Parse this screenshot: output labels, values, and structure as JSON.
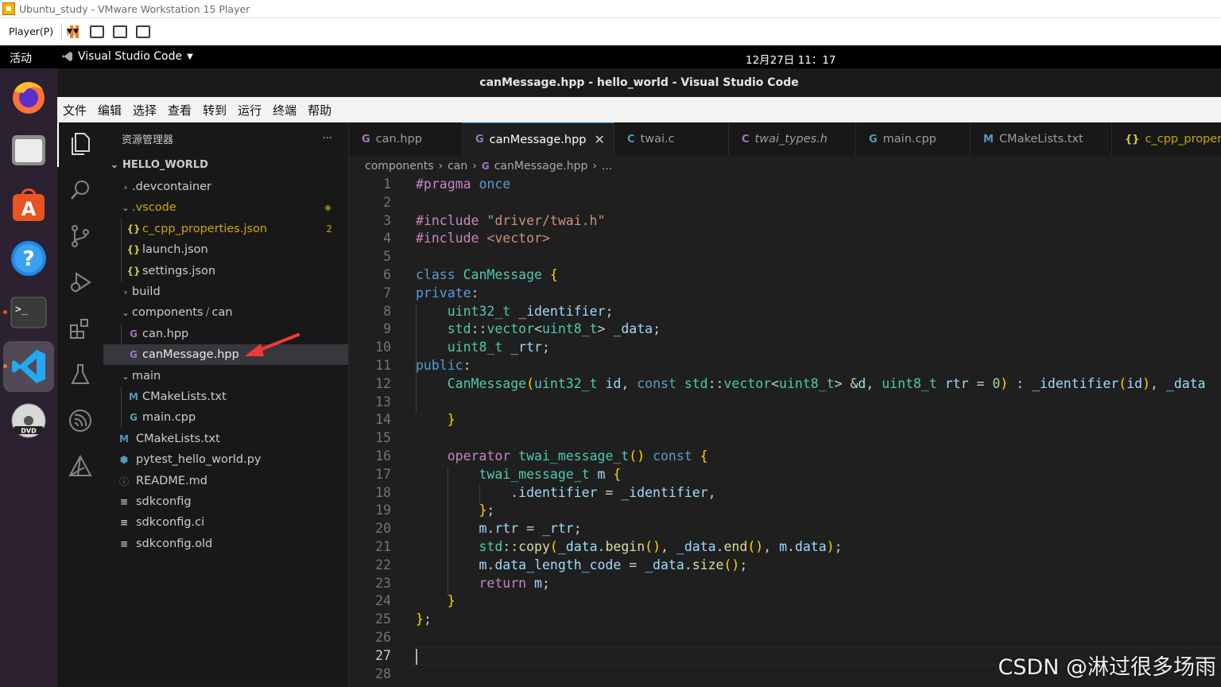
{
  "vm": {
    "title": "Ubuntu_study - VMware Workstation 15 Player",
    "player_label": "Player(P)"
  },
  "topbar": {
    "activities": "活动",
    "app_menu": "Visual Studio Code",
    "clock": "12月27日  11：17"
  },
  "dock": {
    "items": [
      "firefox-icon",
      "files-icon",
      "software-icon",
      "help-icon",
      "terminal-icon",
      "vscode-icon",
      "dvd-icon"
    ]
  },
  "window": {
    "title": "canMessage.hpp - hello_world - Visual Studio Code"
  },
  "menubar": {
    "items": [
      "文件",
      "编辑",
      "选择",
      "查看",
      "转到",
      "运行",
      "终端",
      "帮助"
    ]
  },
  "sidebar": {
    "header": "资源管理器",
    "more": "···",
    "root": "HELLO_WORLD",
    "items": [
      {
        "label": ".devcontainer",
        "icon": "chevron-right"
      },
      {
        "label": ".vscode",
        "icon": "chevron-down"
      },
      {
        "label": "c_cpp_properties.json",
        "icon": "{}",
        "badge": "2"
      },
      {
        "label": "launch.json",
        "icon": "{}"
      },
      {
        "label": "settings.json",
        "icon": "{}"
      },
      {
        "label": "build",
        "icon": "chevron-right"
      },
      {
        "label": "components",
        "label2": "can",
        "icon": "chevron-down"
      },
      {
        "label": "can.hpp",
        "icon": "C++"
      },
      {
        "label": "canMessage.hpp",
        "icon": "C++"
      },
      {
        "label": "main",
        "icon": "chevron-down"
      },
      {
        "label": "CMakeLists.txt",
        "icon": "M"
      },
      {
        "label": "main.cpp",
        "icon": "C++"
      },
      {
        "label": "CMakeLists.txt",
        "icon": "M"
      },
      {
        "label": "pytest_hello_world.py",
        "icon": "python"
      },
      {
        "label": "README.md",
        "icon": "info"
      },
      {
        "label": "sdkconfig",
        "icon": "lines"
      },
      {
        "label": "sdkconfig.ci",
        "icon": "lines"
      },
      {
        "label": "sdkconfig.old",
        "icon": "lines"
      }
    ]
  },
  "tabs": [
    {
      "label": "can.hpp",
      "icon": "C++"
    },
    {
      "label": "canMessage.hpp",
      "icon": "C++",
      "active": true
    },
    {
      "label": "twai.c",
      "icon": "C"
    },
    {
      "label": "twai_types.h",
      "icon": "C"
    },
    {
      "label": "main.cpp",
      "icon": "C++"
    },
    {
      "label": "CMakeLists.txt",
      "icon": "M"
    },
    {
      "label": "c_cpp_proper",
      "icon": "{}"
    }
  ],
  "breadcrumb": {
    "parts": [
      "components",
      "can",
      "canMessage.hpp",
      "..."
    ]
  },
  "editor": {
    "line_numbers": [
      "1",
      "2",
      "3",
      "4",
      "5",
      "6",
      "7",
      "8",
      "9",
      "10",
      "11",
      "12",
      "13",
      "14",
      "15",
      "16",
      "17",
      "18",
      "19",
      "20",
      "21",
      "22",
      "23",
      "24",
      "25",
      "26",
      "27",
      "28"
    ],
    "current_line": "27",
    "lines": [
      "#pragma once",
      "",
      "#include \"driver/twai.h\"",
      "#include <vector>",
      "",
      "class CanMessage {",
      "private:",
      "    uint32_t _identifier;",
      "    std::vector<uint8_t> _data;",
      "    uint8_t _rtr;",
      "public:",
      "    CanMessage(uint32_t id, const std::vector<uint8_t> &d, uint8_t rtr = 0) : _identifier(id), _data",
      "",
      "    }",
      "",
      "    operator twai_message_t() const {",
      "        twai_message_t m {",
      "            .identifier = _identifier,",
      "        };",
      "        m.rtr = _rtr;",
      "        std::copy(_data.begin(), _data.end(), m.data);",
      "        m.data_length_code = _data.size();",
      "        return m;",
      "    }",
      "};",
      "",
      "",
      ""
    ]
  },
  "watermark": "CSDN @淋过很多场雨"
}
